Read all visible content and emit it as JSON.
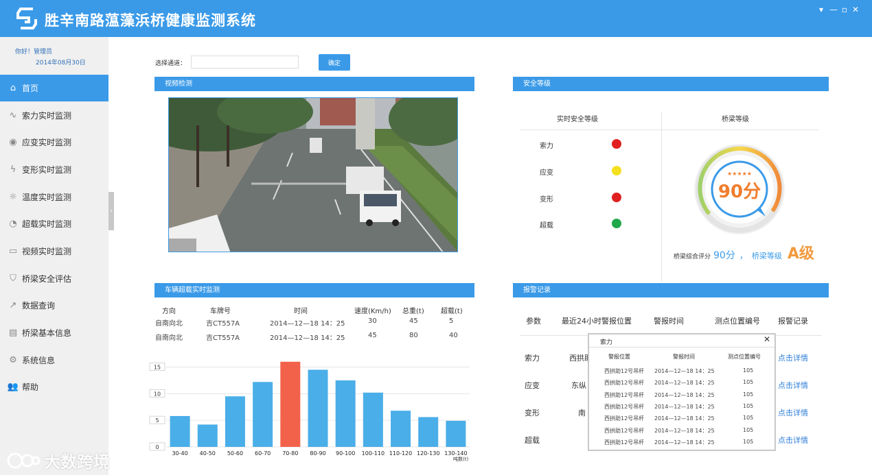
{
  "app": {
    "title": "胜辛南路蕰藻浜桥健康监测系统"
  },
  "window": {
    "minimize": "▾",
    "restore": "▫",
    "close": "✕"
  },
  "user": {
    "greeting": "你好！管理员",
    "date": "2014年08月30日"
  },
  "sidebar": {
    "items": [
      {
        "label": "首页",
        "icon": "home-icon",
        "glyph": "⌂",
        "active": true
      },
      {
        "label": "索力实时监测",
        "icon": "pulse-icon",
        "glyph": "∿",
        "active": false
      },
      {
        "label": "应变实时监测",
        "icon": "eye-icon",
        "glyph": "◉",
        "active": false
      },
      {
        "label": "变形实时监测",
        "icon": "lightning-icon",
        "glyph": "ϟ",
        "active": false
      },
      {
        "label": "温度实时监测",
        "icon": "sun-icon",
        "glyph": "☼",
        "active": false
      },
      {
        "label": "超载实时监测",
        "icon": "gauge-icon",
        "glyph": "◔",
        "active": false
      },
      {
        "label": "视频实时监测",
        "icon": "monitor-icon",
        "glyph": "▭",
        "active": false
      },
      {
        "label": "桥梁安全评估",
        "icon": "shield-icon",
        "glyph": "⛉",
        "active": false
      },
      {
        "label": "数据查询",
        "icon": "chart-line-icon",
        "glyph": "↗",
        "active": false
      },
      {
        "label": "桥梁基本信息",
        "icon": "document-icon",
        "glyph": "▤",
        "active": false
      },
      {
        "label": "系统信息",
        "icon": "gears-icon",
        "glyph": "⚙",
        "active": false
      },
      {
        "label": "帮助",
        "icon": "users-icon",
        "glyph": "👥",
        "active": false
      }
    ]
  },
  "channel": {
    "label": "选择通道：",
    "value": "",
    "placeholder": "",
    "ok": "确定"
  },
  "video": {
    "title": "视频检测"
  },
  "safety": {
    "title": "安全等级",
    "realtime_header": "实时安全等级",
    "bridge_header": "桥梁等级",
    "rows": [
      {
        "label": "索力",
        "color": "#e02020"
      },
      {
        "label": "应变",
        "color": "#f5e020"
      },
      {
        "label": "变形",
        "color": "#e02020"
      },
      {
        "label": "超载",
        "color": "#1fa94a"
      }
    ],
    "score_display": "90分",
    "score": 90,
    "stars": "★★★★★",
    "summary_label": "桥梁综合评分",
    "summary_score": "90分",
    "summary_sep": "，",
    "level_label": "桥梁等级",
    "level": "A级"
  },
  "overload": {
    "title": "车辆超载实时监测",
    "headers": [
      "方向",
      "车牌号",
      "时间",
      "速度(Km/h)",
      "总重(t)",
      "超载(t)"
    ],
    "rows": [
      [
        "自南向北",
        "吉CT557A",
        "2014—12—18  14：25",
        "30",
        "45",
        "5"
      ],
      [
        "自南向北",
        "吉CT557A",
        "2014—12—18  14：25",
        "45",
        "80",
        "40"
      ]
    ]
  },
  "chart_data": {
    "type": "bar",
    "categories": [
      "30-40",
      "40-50",
      "50-60",
      "60-70",
      "70-80",
      "80-90",
      "90-100",
      "100-110",
      "110-120",
      "120-130",
      "130-140"
    ],
    "values": [
      5.8,
      4.2,
      9.5,
      12.2,
      16,
      14.5,
      12.5,
      10.2,
      6.8,
      5.6,
      4.9
    ],
    "highlight_index": 4,
    "colors": {
      "bar": "#4aaee8",
      "highlight": "#f2624a"
    },
    "yticks": [
      0,
      5,
      10,
      15
    ],
    "ylim": [
      0,
      17
    ],
    "xlabel": "吨数(t)",
    "ylabel": "",
    "grid": true
  },
  "alarm": {
    "title": "报警记录",
    "headers": [
      "参数",
      "最近24小时警报位置",
      "警报时间",
      "测点位置编号",
      "报警记录"
    ],
    "rows": [
      {
        "param": "索力",
        "loc": "西拱助",
        "link": "点击详情"
      },
      {
        "param": "应变",
        "loc": "东纵",
        "link": "点击详情"
      },
      {
        "param": "变形",
        "loc": "南",
        "link": "点击详情"
      },
      {
        "param": "超载",
        "loc": "",
        "link": "点击详情"
      }
    ]
  },
  "popup": {
    "title": "索力",
    "close": "✕",
    "headers": [
      "警报位置",
      "警报时间",
      "测点位置编号"
    ],
    "rows": [
      [
        "西拱助12号吊杆",
        "2014—12—18    14：25",
        "105"
      ],
      [
        "西拱助12号吊杆",
        "2014—12—18    14：25",
        "105"
      ],
      [
        "西拱助12号吊杆",
        "2014—12—18    14：25",
        "105"
      ],
      [
        "西拱助12号吊杆",
        "2014—12—18    14：25",
        "105"
      ],
      [
        "西拱助12号吊杆",
        "2014—12—18    14：25",
        "105"
      ],
      [
        "西拱助12号吊杆",
        "2014—12—18    14：25",
        "105"
      ],
      [
        "西拱助12号吊杆",
        "2014—12—18    14：25",
        "105"
      ]
    ]
  },
  "watermark": {
    "text": "大数跨境"
  }
}
